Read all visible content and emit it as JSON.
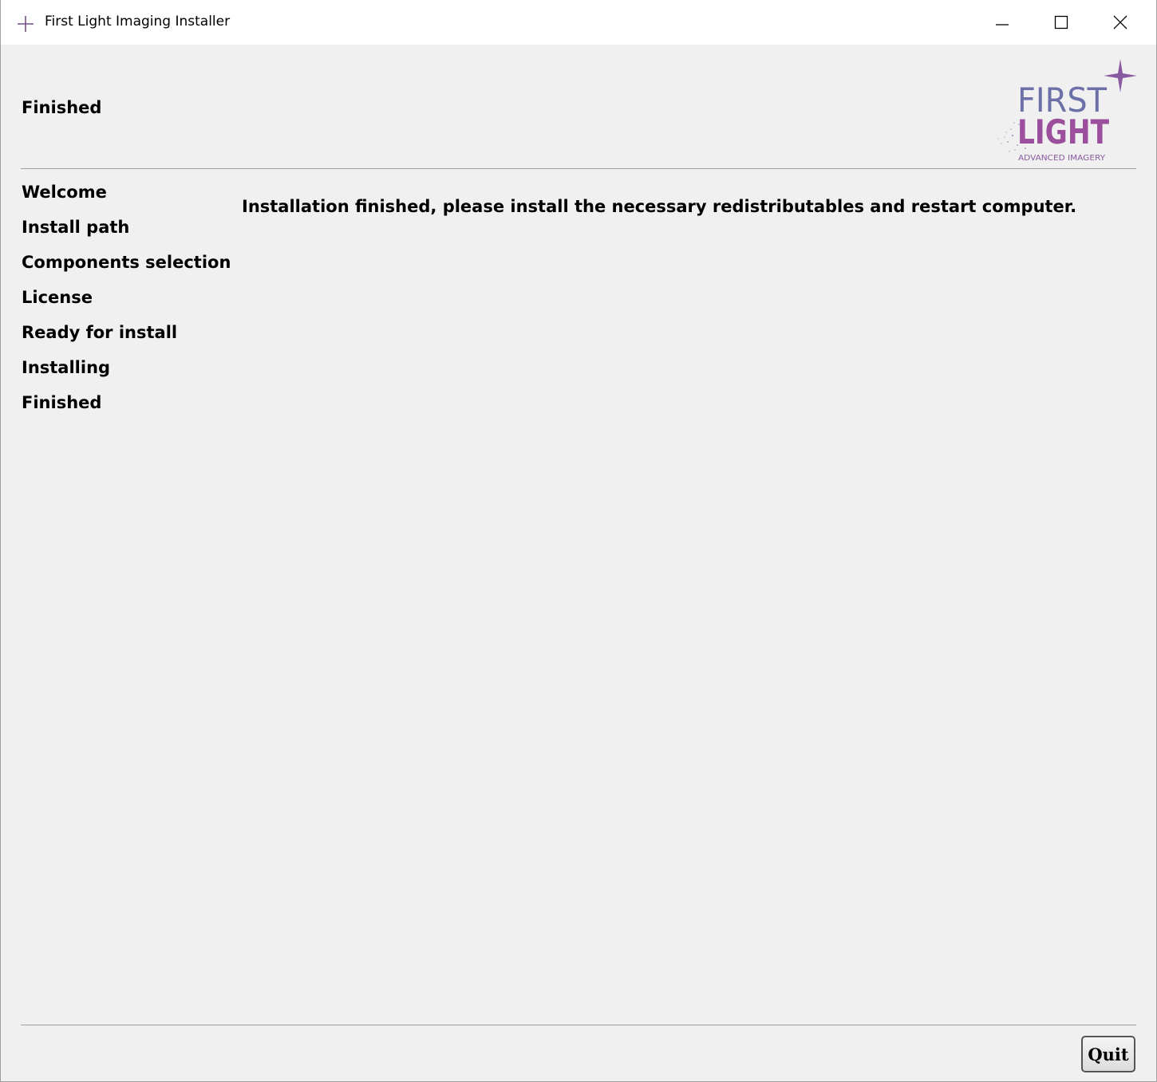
{
  "window": {
    "title": "First Light Imaging Installer",
    "controls": {
      "minimize": "minimize-icon",
      "maximize": "maximize-icon",
      "close": "close-icon"
    }
  },
  "header": {
    "page_title": "Finished",
    "logo": {
      "line1": "FIRST",
      "line2": "LIGHT",
      "tagline": "ADVANCED IMAGERY"
    }
  },
  "steps": [
    {
      "label": "Welcome"
    },
    {
      "label": "Install path"
    },
    {
      "label": "Components selection"
    },
    {
      "label": "License"
    },
    {
      "label": "Ready for install"
    },
    {
      "label": "Installing"
    },
    {
      "label": "Finished"
    }
  ],
  "main": {
    "message": "Installation finished, please install the necessary redistributables and restart computer."
  },
  "footer": {
    "quit_label": "Quit"
  },
  "colors": {
    "brand_blue": "#6b70a8",
    "brand_purple": "#9b4f9c",
    "background": "#f0f0f0"
  }
}
